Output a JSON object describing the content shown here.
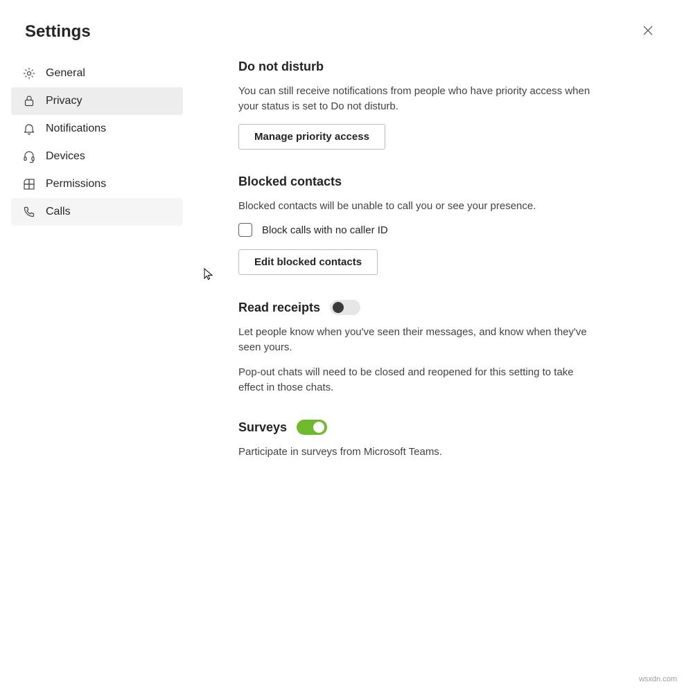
{
  "header": {
    "title": "Settings"
  },
  "sidebar": {
    "items": [
      {
        "label": "General",
        "icon": "gear"
      },
      {
        "label": "Privacy",
        "icon": "lock"
      },
      {
        "label": "Notifications",
        "icon": "bell"
      },
      {
        "label": "Devices",
        "icon": "headset"
      },
      {
        "label": "Permissions",
        "icon": "grid"
      },
      {
        "label": "Calls",
        "icon": "phone"
      }
    ],
    "selected_index": 1,
    "hover_index": 5
  },
  "main": {
    "dnd": {
      "title": "Do not disturb",
      "desc": "You can still receive notifications from people who have priority access when your status is set to Do not disturb.",
      "button": "Manage priority access"
    },
    "blocked": {
      "title": "Blocked contacts",
      "desc": "Blocked contacts will be unable to call you or see your presence.",
      "checkbox_label": "Block calls with no caller ID",
      "checkbox_checked": false,
      "button": "Edit blocked contacts"
    },
    "read_receipts": {
      "title": "Read receipts",
      "toggle_on": false,
      "desc1": "Let people know when you've seen their messages, and know when they've seen yours.",
      "desc2": "Pop-out chats will need to be closed and reopened for this setting to take effect in those chats."
    },
    "surveys": {
      "title": "Surveys",
      "toggle_on": true,
      "desc": "Participate in surveys from Microsoft Teams."
    }
  },
  "watermark": "wsxdn.com"
}
